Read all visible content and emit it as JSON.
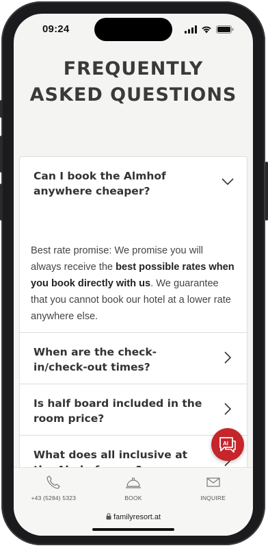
{
  "status_bar": {
    "time": "09:24"
  },
  "page": {
    "heading_line1": "FREQUENTLY",
    "heading_line2": "ASKED QUESTIONS"
  },
  "faq": {
    "items": [
      {
        "question": "Can I book the Almhof anywhere cheaper?",
        "expanded": true
      },
      {
        "question": "When are the check-in/check-out times?",
        "expanded": false
      },
      {
        "question": "Is half board included in the room price?",
        "expanded": false
      },
      {
        "question": "What does all inclusive at the Almhof mean?",
        "expanded": false
      }
    ],
    "answer": {
      "part1": "Best rate promise: We promise you will always receive the ",
      "bold": "best possible rates when you book directly with us",
      "part2": ". We guarantee that you cannot book our hotel at a lower rate anywhere else."
    }
  },
  "chat_button": {
    "icon": "chat-ai-icon",
    "label": "AI",
    "color": "#c6252b"
  },
  "bottom_nav": {
    "phone": {
      "label": "+43 (5284) 5323",
      "icon": "phone-icon"
    },
    "book": {
      "label": "BOOK",
      "icon": "bell-icon"
    },
    "inquire": {
      "label": "INQUIRE",
      "icon": "envelope-icon"
    }
  },
  "browser": {
    "url": "familyresort.at",
    "icon": "lock-icon"
  }
}
